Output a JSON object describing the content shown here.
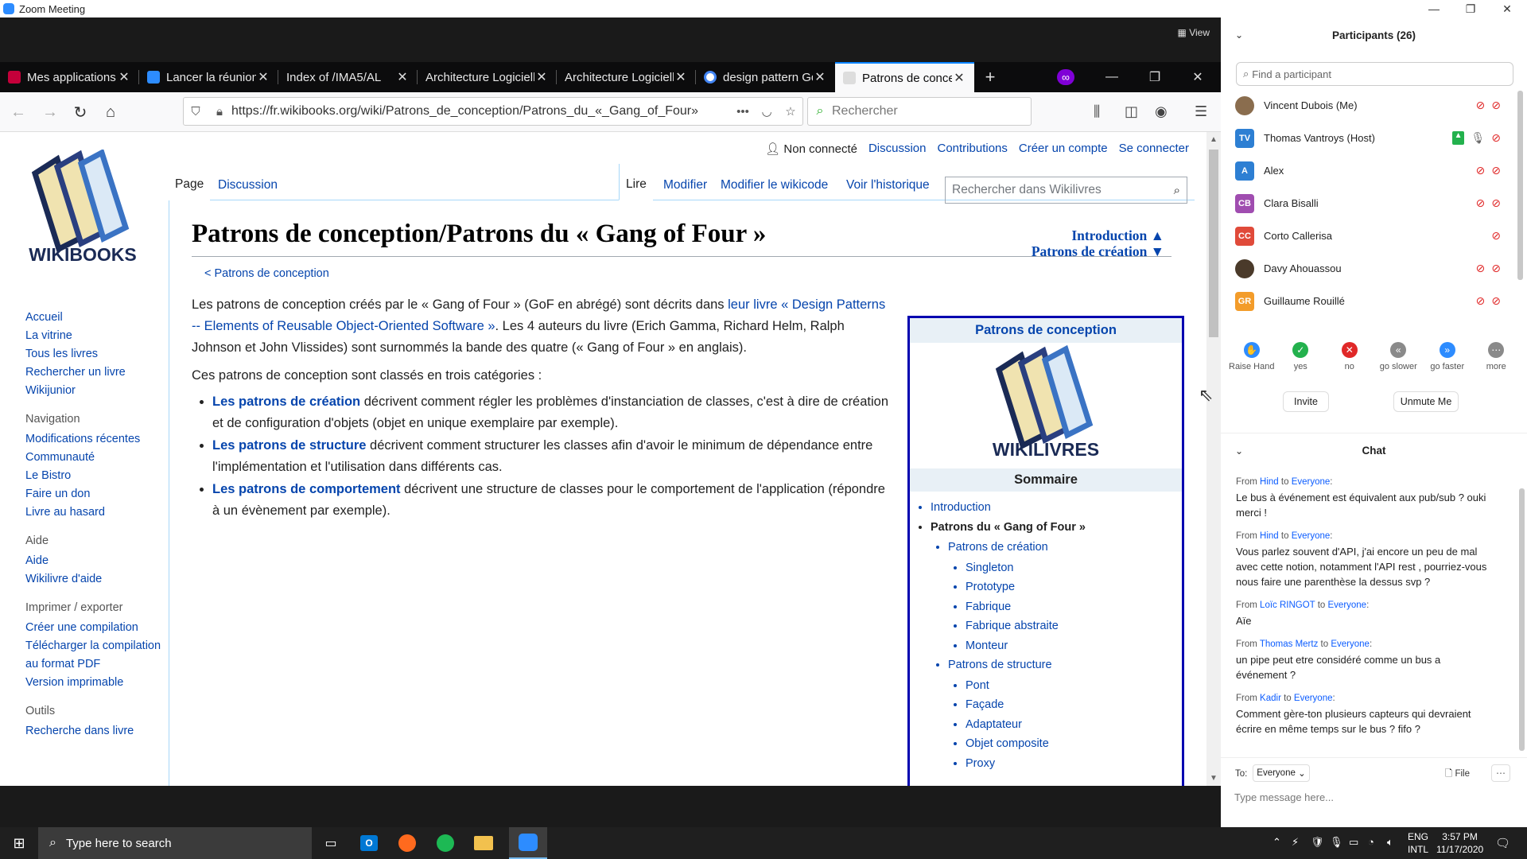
{
  "zoom": {
    "title": "Zoom Meeting",
    "view_label": "View"
  },
  "firefox": {
    "tabs": [
      {
        "label": "Mes applications",
        "color": "#c4003a"
      },
      {
        "label": "Lancer la réunion",
        "color": "#2d8cff"
      },
      {
        "label": "Index of /IMA5/AL",
        "color": ""
      },
      {
        "label": "Architecture Logicielle",
        "color": ""
      },
      {
        "label": "Architecture Logicielle",
        "color": ""
      },
      {
        "label": "design pattern Gof",
        "color": "#4285f4"
      },
      {
        "label": "Patrons de conception",
        "color": "#777777",
        "active": true
      }
    ],
    "url": "https://fr.wikibooks.org/wiki/Patrons_de_conception/Patrons_du_«_Gang_of_Four»",
    "search_placeholder": "Rechercher"
  },
  "wiki": {
    "logo_text": "WIKIBOOKS",
    "nav_main": [
      "Accueil",
      "La vitrine",
      "Tous les livres",
      "Rechercher un livre",
      "Wikijunior"
    ],
    "nav_navigation_title": "Navigation",
    "nav_navigation": [
      "Modifications récentes",
      "Communauté",
      "Le Bistro",
      "Faire un don",
      "Livre au hasard"
    ],
    "nav_aide_title": "Aide",
    "nav_aide": [
      "Aide",
      "Wikilivre d'aide"
    ],
    "nav_export_title": "Imprimer / exporter",
    "nav_export": [
      "Créer une compilation",
      "Télécharger la compilation au format PDF",
      "Version imprimable"
    ],
    "nav_outils_title": "Outils",
    "nav_outils": [
      "Recherche dans livre"
    ],
    "user_links": {
      "status": "Non connecté",
      "discussion": "Discussion",
      "contributions": "Contributions",
      "create": "Créer un compte",
      "login": "Se connecter"
    },
    "tab_page": "Page",
    "tab_discussion": "Discussion",
    "tab_read": "Lire",
    "tab_edit": "Modifier",
    "tab_edit_source": "Modifier le wikicode",
    "tab_history": "Voir l'historique",
    "search_placeholder": "Rechercher dans Wikilivres",
    "title": "Patrons de conception/Patrons du « Gang of Four »",
    "nav_intro": "Introduction ▲",
    "nav_creation": "Patrons de création ▼",
    "back_link": "< Patrons de conception",
    "para1_a": "Les patrons de conception créés par le « Gang of Four » (GoF en abrégé) sont décrits dans ",
    "para1_link": "leur livre « Design Patterns -- Elements of Reusable Object-Oriented Software »",
    "para1_b": ". Les 4 auteurs du livre (Erich Gamma, Richard Helm, Ralph Johnson et John Vlissides) sont surnommés la bande des quatre (« Gang of Four » en anglais).",
    "para2": "Ces patrons de conception sont classés en trois catégories :",
    "bullets": [
      {
        "link": "Les patrons de création",
        "text": " décrivent comment régler les problèmes d'instanciation de classes, c'est à dire de création et de configuration d'objets (objet en unique exemplaire par exemple)."
      },
      {
        "link": "Les patrons de structure",
        "text": " décrivent comment structurer les classes afin d'avoir le minimum de dépendance entre l'implémentation et l'utilisation dans différents cas."
      },
      {
        "link": "Les patrons de comportement",
        "text": " décrivent une structure de classes pour le comportement de l'application (répondre à un évènement par exemple)."
      }
    ],
    "infobox_title": "Patrons de conception",
    "infobox_logo_text": "WIKILIVRES",
    "sommaire": "Sommaire",
    "toc": {
      "introduction": "Introduction",
      "current": "Patrons du « Gang of Four »",
      "creation": "Patrons de création",
      "creation_items": [
        "Singleton",
        "Prototype",
        "Fabrique",
        "Fabrique abstraite",
        "Monteur"
      ],
      "structure": "Patrons de structure",
      "structure_items": [
        "Pont",
        "Façade",
        "Adaptateur",
        "Objet composite",
        "Proxy"
      ]
    }
  },
  "participants": {
    "header": "Participants (26)",
    "find_placeholder": "Find a participant",
    "list": [
      {
        "name": "Vincent Dubois (Me)",
        "initials": "",
        "color": "#8a6d4e"
      },
      {
        "name": "Thomas Vantroys (Host)",
        "initials": "TV",
        "color": "#2d7fd3"
      },
      {
        "name": "Alex",
        "initials": "A",
        "color": "#2d7fd3"
      },
      {
        "name": "Clara Bisalli",
        "initials": "CB",
        "color": "#a04db0"
      },
      {
        "name": "Corto Callerisa",
        "initials": "CC",
        "color": "#e04a3a"
      },
      {
        "name": "Davy Ahouassou",
        "initials": "",
        "color": "#4a3a2a"
      },
      {
        "name": "Guillaume Rouillé",
        "initials": "GR",
        "color": "#f39c2a"
      }
    ],
    "reactions": [
      {
        "label": "Raise Hand",
        "color": "#2d8cff",
        "glyph": "✋"
      },
      {
        "label": "yes",
        "color": "#23b14d",
        "glyph": "✓"
      },
      {
        "label": "no",
        "color": "#e02828",
        "glyph": "✕"
      },
      {
        "label": "go slower",
        "color": "#8a8a8a",
        "glyph": "«"
      },
      {
        "label": "go faster",
        "color": "#2d8cff",
        "glyph": "»"
      },
      {
        "label": "more",
        "color": "#8a8a8a",
        "glyph": "⋯"
      }
    ],
    "invite": "Invite",
    "unmute": "Unmute Me"
  },
  "chat": {
    "header": "Chat",
    "messages": [
      {
        "from": "Hind",
        "to": "Everyone",
        "text": "Le bus à événement est équivalent aux pub/sub ? ouki merci !"
      },
      {
        "from": "Hind",
        "to": "Everyone",
        "text": "Vous parlez souvent d'API, j'ai encore un peu de mal avec cette notion, notamment l'API rest , pourriez-vous nous faire une parenthèse la dessus svp ?"
      },
      {
        "from": "Loïc RINGOT",
        "to": "Everyone",
        "text": "Aïe"
      },
      {
        "from": "Thomas Mertz",
        "to": "Everyone",
        "text": "un pipe peut etre considéré comme un bus a événement ?"
      },
      {
        "from": "Kadir",
        "to": "Everyone",
        "text": "Comment gère-ton plusieurs capteurs qui devraient écrire en même temps sur le bus ? fifo ?"
      }
    ],
    "from_word": "From",
    "to_word": "to",
    "to_label": "To:",
    "to_value": "Everyone",
    "file": "File",
    "placeholder": "Type message here..."
  },
  "taskbar": {
    "search": "Type here to search",
    "lang_top": "ENG",
    "lang_bottom": "INTL",
    "time": "3:57 PM",
    "date": "11/17/2020"
  }
}
